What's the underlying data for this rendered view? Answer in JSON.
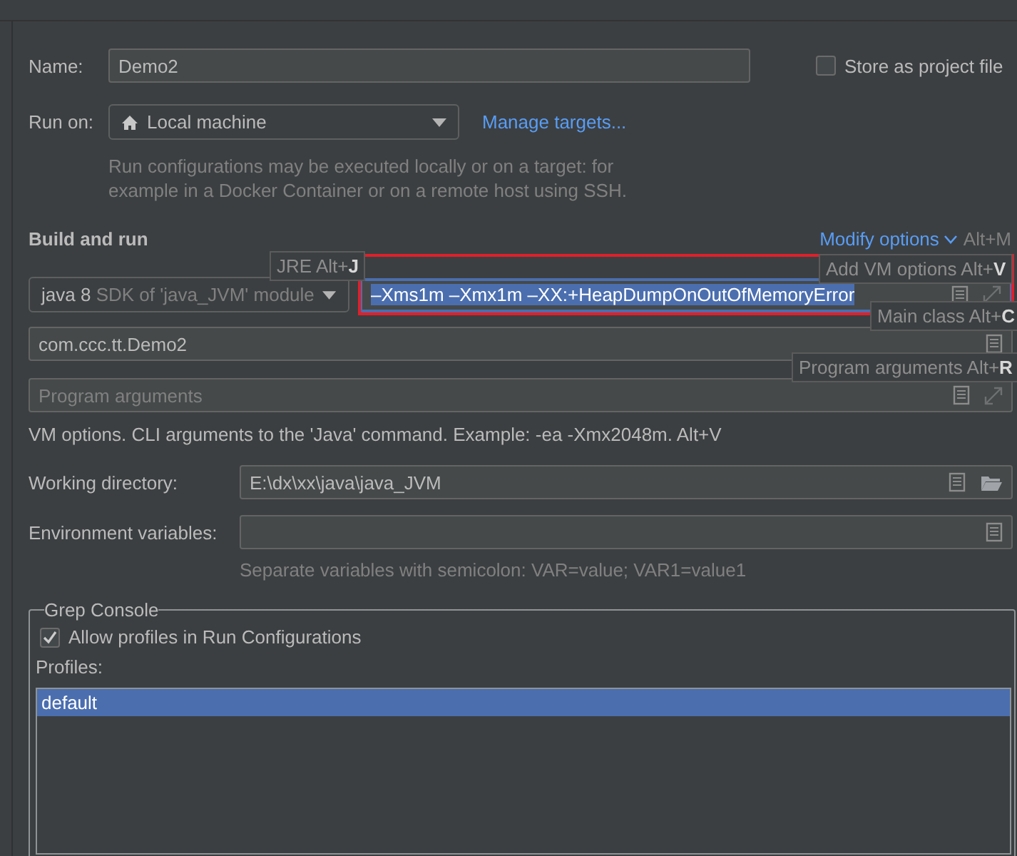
{
  "name": {
    "label": "Name:",
    "value": "Demo2"
  },
  "store_as_project_file": {
    "label": "Store as project file",
    "checked": false
  },
  "run_on": {
    "label": "Run on:",
    "value": "Local machine",
    "link": "Manage targets...",
    "description": "Run configurations may be executed locally or on a target: for example in a Docker Container or on a remote host using SSH."
  },
  "build_and_run": {
    "title": "Build and run",
    "modify_options": "Modify options",
    "modify_shortcut": "Alt+M",
    "jre": {
      "value": "java 8",
      "hint": "SDK of 'java_JVM' module"
    },
    "vm_options": {
      "value": "–Xms1m –Xmx1m –XX:+HeapDumpOnOutOfMemoryError",
      "selected": true
    },
    "main_class": {
      "value": "com.ccc.tt.Demo2"
    },
    "program_arguments": {
      "placeholder": "Program arguments"
    },
    "hint": "VM options. CLI arguments to the 'Java' command. Example: -ea -Xmx2048m. Alt+V"
  },
  "tooltips": [
    {
      "text": "JRE Alt+**J**"
    },
    {
      "text": "Add VM options Alt+**V**"
    },
    {
      "text": "Main class Alt+**C**"
    },
    {
      "text": "Program arguments Alt+**R**"
    }
  ],
  "working_directory": {
    "label": "Working directory:",
    "value": "E:\\dx\\xx\\java\\java_JVM"
  },
  "environment_variables": {
    "label": "Environment variables:",
    "hint": "Separate variables with semicolon: VAR=value; VAR1=value1"
  },
  "grep_console": {
    "title": "Grep Console",
    "allow_profiles": {
      "label": "Allow profiles in Run Configurations",
      "checked": true
    },
    "profiles_label": "Profiles:",
    "profiles": [
      {
        "name": "default",
        "selected": true
      }
    ]
  }
}
